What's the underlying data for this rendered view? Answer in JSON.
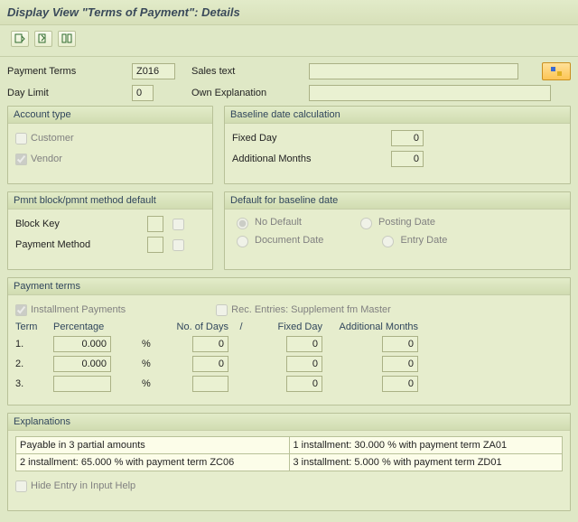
{
  "title": "Display View \"Terms of Payment\": Details",
  "header": {
    "paymentTermsLabel": "Payment Terms",
    "paymentTermsValue": "Z016",
    "salesTextLabel": "Sales text",
    "salesTextValue": "",
    "dayLimitLabel": "Day Limit",
    "dayLimitValue": "0",
    "ownExplLabel": "Own Explanation",
    "ownExplValue": ""
  },
  "accountType": {
    "title": "Account type",
    "customer": "Customer",
    "vendor": "Vendor",
    "customerChecked": false,
    "vendorChecked": true
  },
  "baselineCalc": {
    "title": "Baseline date calculation",
    "fixedDayLabel": "Fixed Day",
    "fixedDayValue": "0",
    "addMonthsLabel": "Additional Months",
    "addMonthsValue": "0"
  },
  "pmntBlock": {
    "title": "Pmnt block/pmnt method default",
    "blockKeyLabel": "Block Key",
    "paymentMethodLabel": "Payment Method"
  },
  "defaultBaseline": {
    "title": "Default for baseline date",
    "noDefault": "No Default",
    "postingDate": "Posting Date",
    "documentDate": "Document Date",
    "entryDate": "Entry Date"
  },
  "paymentTerms": {
    "title": "Payment terms",
    "installmentLabel": "Installment Payments",
    "installmentChecked": true,
    "recEntriesLabel": "Rec. Entries: Supplement fm Master",
    "col_term": "Term",
    "col_pct": "Percentage",
    "col_days": "No. of Days",
    "col_sep": "/",
    "col_fixed": "Fixed Day",
    "col_addm": "Additional Months",
    "rows": [
      {
        "n": "1.",
        "pct": "0.000",
        "days": "0",
        "fixed": "0",
        "addm": "0"
      },
      {
        "n": "2.",
        "pct": "0.000",
        "days": "0",
        "fixed": "0",
        "addm": "0"
      },
      {
        "n": "3.",
        "pct": "",
        "days": "",
        "fixed": "0",
        "addm": "0"
      }
    ]
  },
  "explanations": {
    "title": "Explanations",
    "cells": [
      "Payable in 3 partial amounts",
      "1 installment: 30.000 % with payment term ZA01",
      "2 installment: 65.000 % with payment term ZC06",
      "3 installment: 5.000 % with payment term ZD01"
    ],
    "hideEntry": "Hide Entry in Input Help"
  }
}
